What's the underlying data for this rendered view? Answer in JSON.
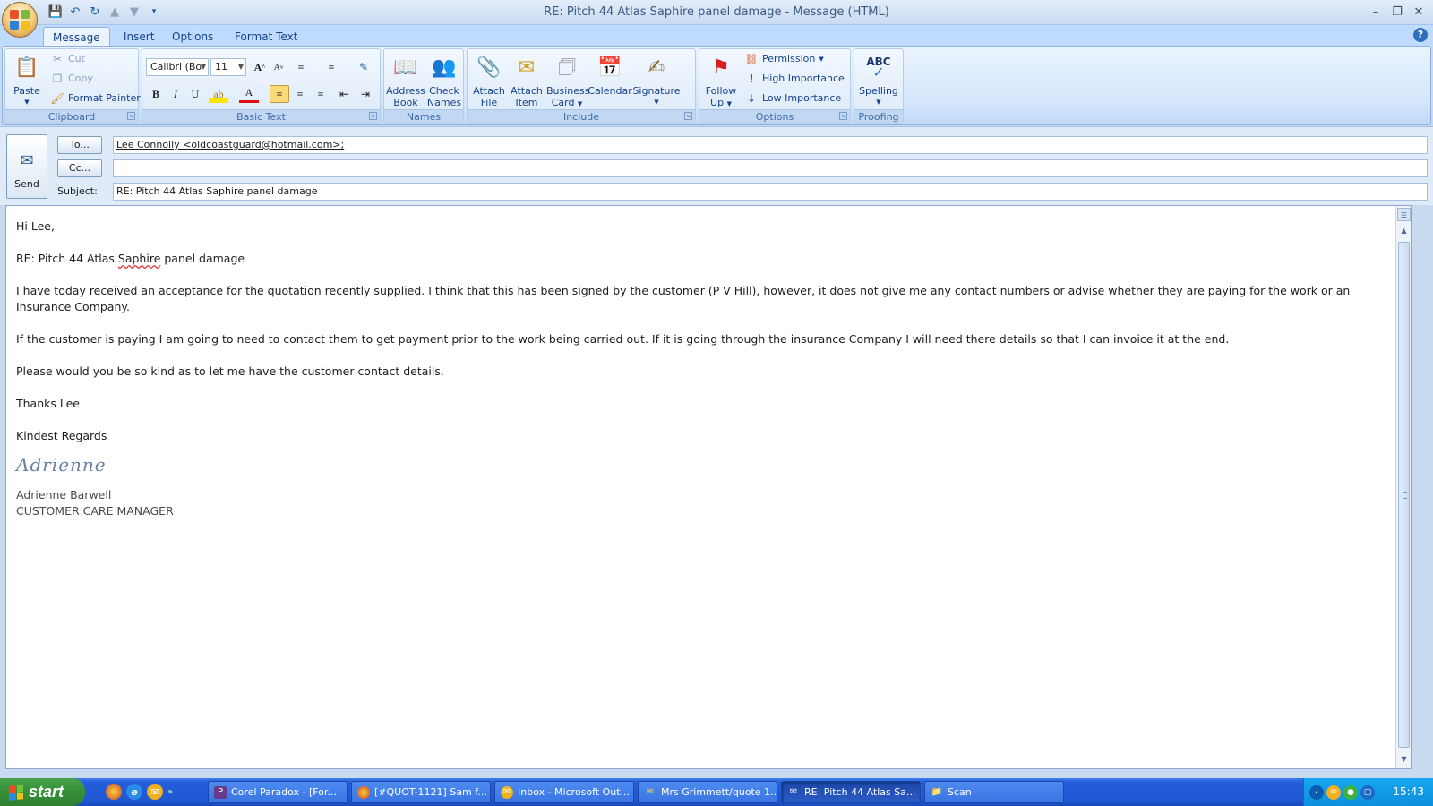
{
  "window": {
    "title": "RE: Pitch 44 Atlas Saphire panel damage - Message (HTML)"
  },
  "tabs": [
    "Message",
    "Insert",
    "Options",
    "Format Text"
  ],
  "ribbon": {
    "clipboard": {
      "label": "Clipboard",
      "paste": "Paste",
      "cut": "Cut",
      "copy": "Copy",
      "format_painter": "Format Painter"
    },
    "basic_text": {
      "label": "Basic Text",
      "font": "Calibri (Bo",
      "size": "11"
    },
    "names": {
      "label": "Names",
      "address_book": [
        "Address",
        "Book"
      ],
      "check_names": [
        "Check",
        "Names"
      ]
    },
    "include": {
      "label": "Include",
      "attach_file": [
        "Attach",
        "File"
      ],
      "attach_item": [
        "Attach",
        "Item"
      ],
      "business_card": [
        "Business",
        "Card"
      ],
      "calendar": "Calendar",
      "signature": "Signature"
    },
    "options": {
      "label": "Options",
      "follow_up": [
        "Follow",
        "Up"
      ],
      "permission": "Permission",
      "high_importance": "High Importance",
      "low_importance": "Low Importance"
    },
    "proofing": {
      "label": "Proofing",
      "spelling": "Spelling",
      "abc": "ABC"
    }
  },
  "compose": {
    "send": "Send",
    "to_button": "To...",
    "cc_button": "Cc...",
    "subject_label": "Subject:",
    "to_value": "Lee Connolly <oldcoastguard@hotmail.com>;",
    "cc_value": "",
    "subject_value": "RE: Pitch 44 Atlas Saphire panel damage"
  },
  "message": {
    "greeting": "Hi Lee,",
    "ref_prefix": "RE: Pitch 44 Atlas ",
    "ref_misspelled": "Saphire",
    "ref_suffix": " panel damage",
    "para1": "I have today received an acceptance for the quotation recently supplied.  I think that this has been signed by the customer  (P V Hill), however, it does not give me any contact numbers or advise whether they are paying for the work or an Insurance Company.",
    "para2": "If the customer is paying I am going to need to contact them to get payment prior to the work being carried out.  If it is going through the insurance Company I will need there details so that I can invoice it at the end.",
    "para3": "Please would you be so kind as to let me have the customer contact details.",
    "thanks": "Thanks Lee",
    "regards": "Kindest Regards",
    "signature_script": "Adrienne",
    "sig_name": "Adrienne Barwell",
    "sig_title": "CUSTOMER CARE MANAGER"
  },
  "taskbar": {
    "start": "start",
    "items": [
      "Corel Paradox - [For...",
      "[#QUOT-1121] Sam f...",
      "Inbox - Microsoft Out...",
      "Mrs Grimmett/quote 1...",
      "RE: Pitch 44 Atlas Sa...",
      "Scan"
    ],
    "clock": "15:43"
  }
}
